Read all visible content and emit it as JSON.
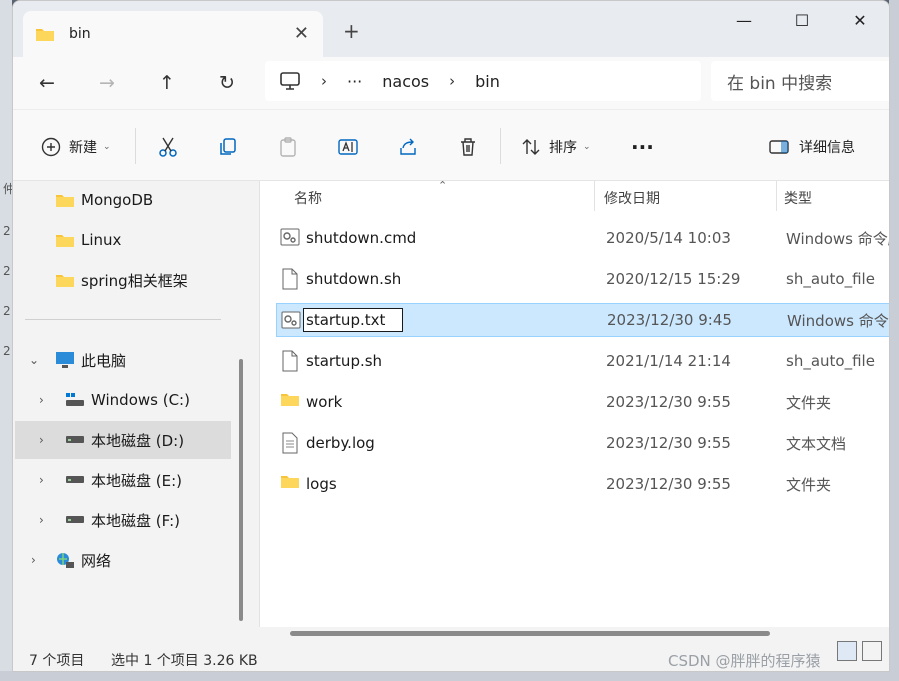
{
  "window": {
    "tab_title": "bin",
    "new_tab": "+",
    "controls": {
      "minimize": "—",
      "maximize": "☐",
      "close": "✕"
    }
  },
  "nav": {
    "back": "←",
    "forward": "→",
    "up": "↑",
    "refresh": "↻",
    "breadcrumb": {
      "overflow": "···",
      "seg1": "nacos",
      "seg2": "bin",
      "sep": "›"
    },
    "search_placeholder": "在 bin 中搜索"
  },
  "toolbar": {
    "new_label": "新建",
    "sort_label": "排序",
    "more_label": "···",
    "details_label": "详细信息"
  },
  "sidebar": {
    "items": [
      {
        "label": "MongoDB"
      },
      {
        "label": "Linux"
      },
      {
        "label": "spring相关框架"
      },
      {
        "label": "此电脑"
      },
      {
        "label": "Windows (C:)"
      },
      {
        "label": "本地磁盘 (D:)"
      },
      {
        "label": "本地磁盘 (E:)"
      },
      {
        "label": "本地磁盘 (F:)"
      },
      {
        "label": "网络"
      }
    ]
  },
  "columns": {
    "name": "名称",
    "date": "修改日期",
    "type": "类型"
  },
  "files": [
    {
      "name": "shutdown.cmd",
      "date": "2020/5/14 10:03",
      "type": "Windows 命令脚本",
      "icon": "cmd-file-icon"
    },
    {
      "name": "shutdown.sh",
      "date": "2020/12/15 15:29",
      "type": "sh_auto_file",
      "icon": "file-icon"
    },
    {
      "name": "startup.txt",
      "date": "2023/12/30 9:45",
      "type": "Windows 命令脚本",
      "icon": "cmd-file-icon"
    },
    {
      "name": "startup.sh",
      "date": "2021/1/14 21:14",
      "type": "sh_auto_file",
      "icon": "file-icon"
    },
    {
      "name": "work",
      "date": "2023/12/30 9:55",
      "type": "文件夹",
      "icon": "folder-icon"
    },
    {
      "name": "derby.log",
      "date": "2023/12/30 9:55",
      "type": "文本文档",
      "icon": "text-file-icon"
    },
    {
      "name": "logs",
      "date": "2023/12/30 9:55",
      "type": "文件夹",
      "icon": "folder-icon"
    }
  ],
  "status": {
    "count": "7 个项目",
    "selection": "选中 1 个项目  3.26 KB"
  },
  "watermark": "CSDN @胖胖的程序猿",
  "colors": {
    "accent": "#0067c0",
    "selected_row": "#cce8ff",
    "folder": "#f8c53a"
  }
}
